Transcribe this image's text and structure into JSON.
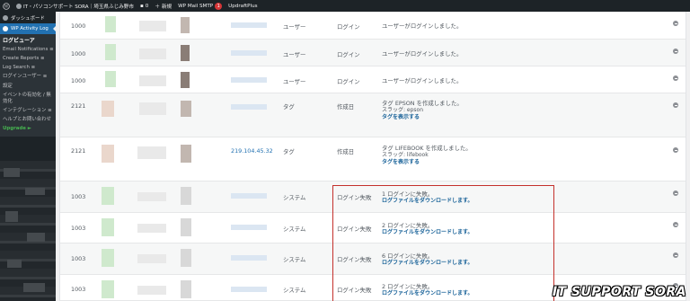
{
  "adminbar": {
    "site_name": "IT・パソコンサポート SORA｜埼玉県ふじみ野市",
    "comments_count": "0",
    "new_label": "新規",
    "smtp_label": "WP Mail SMTP",
    "smtp_badge": "1",
    "updraft_label": "UpdraftPlus"
  },
  "sidebar": {
    "dashboard": "ダッシュボード",
    "active": "WP Activity Log",
    "items": [
      "ログビューア",
      "Email Notifications ≡",
      "Create Reports ≡",
      "Log Search ≡",
      "ログインユーザー ≡",
      "設定",
      "イベントの有効化 / 無効化",
      "インテグレーション ≡",
      "ヘルプとお問い合わせ",
      "Upgrade ►"
    ]
  },
  "rows": [
    {
      "id": "1000",
      "ip": "",
      "type": "ユーザー",
      "event": "ログイン",
      "msg": [
        "ユーザーがログインしました。"
      ],
      "link": ""
    },
    {
      "id": "1000",
      "ip": "",
      "type": "ユーザー",
      "event": "ログイン",
      "msg": [
        "ユーザーがログインしました。"
      ],
      "link": ""
    },
    {
      "id": "1000",
      "ip": "",
      "type": "ユーザー",
      "event": "ログイン",
      "msg": [
        "ユーザーがログインしました。"
      ],
      "link": ""
    },
    {
      "id": "2121",
      "ip": "",
      "type": "タグ",
      "event": "作成日",
      "msg": [
        "タグ EPSON を作成しました。",
        "スラッグ: epson"
      ],
      "link": "タグを表示する"
    },
    {
      "id": "2121",
      "ip": "219.104.45.32",
      "type": "タグ",
      "event": "作成日",
      "msg": [
        "タグ LIFEBOOK を作成しました。",
        "スラッグ: lifebook"
      ],
      "link": "タグを表示する"
    },
    {
      "id": "1003",
      "ip": "",
      "type": "システム",
      "event": "ログイン失敗",
      "msg": [
        "1 ログインに失敗。"
      ],
      "link": "ログファイルをダウンロードします。"
    },
    {
      "id": "1003",
      "ip": "",
      "type": "システム",
      "event": "ログイン失敗",
      "msg": [
        "2 ログインに失敗。"
      ],
      "link": "ログファイルをダウンロードします。"
    },
    {
      "id": "1003",
      "ip": "",
      "type": "システム",
      "event": "ログイン失敗",
      "msg": [
        "6 ログインに失敗。"
      ],
      "link": "ログファイルをダウンロードします。"
    },
    {
      "id": "1003",
      "ip": "",
      "type": "システム",
      "event": "ログイン失敗",
      "msg": [
        "2 ログインに失敗。"
      ],
      "link": "ログファイルをダウンロードします。"
    }
  ],
  "watermark": "IT SUPPORT SORA"
}
